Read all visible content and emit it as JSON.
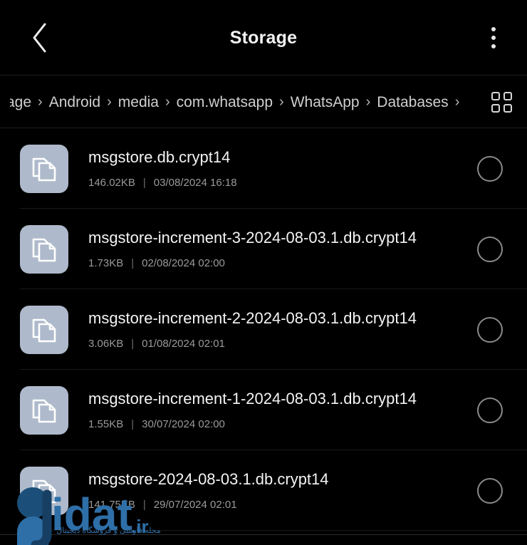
{
  "header": {
    "title": "Storage",
    "back_icon": "chevron-left-icon",
    "menu_icon": "more-vertical-icon"
  },
  "breadcrumb": {
    "separator": "›",
    "items": [
      {
        "label": "rage",
        "truncated": true
      },
      {
        "label": "Android",
        "truncated": false
      },
      {
        "label": "media",
        "truncated": false
      },
      {
        "label": "com.whatsapp",
        "truncated": false
      },
      {
        "label": "WhatsApp",
        "truncated": false
      },
      {
        "label": "Databases",
        "truncated": false
      }
    ],
    "trailing_separator": "›",
    "view_toggle_icon": "grid-view-icon"
  },
  "files": [
    {
      "name": "msgstore.db.crypt14",
      "size": "146.02KB",
      "modified": "03/08/2024 16:18",
      "icon": "file-document-icon",
      "selected": false
    },
    {
      "name": "msgstore-increment-3-2024-08-03.1.db.crypt14",
      "size": "1.73KB",
      "modified": "02/08/2024 02:00",
      "icon": "file-document-icon",
      "selected": false
    },
    {
      "name": "msgstore-increment-2-2024-08-03.1.db.crypt14",
      "size": "3.06KB",
      "modified": "01/08/2024 02:01",
      "icon": "file-document-icon",
      "selected": false
    },
    {
      "name": "msgstore-increment-1-2024-08-03.1.db.crypt14",
      "size": "1.55KB",
      "modified": "30/07/2024 02:00",
      "icon": "file-document-icon",
      "selected": false
    },
    {
      "name": "msgstore-2024-08-03.1.db.crypt14",
      "size": "141.75KB",
      "modified": "29/07/2024 02:01",
      "icon": "file-document-icon",
      "selected": false
    }
  ],
  "meta_separator": "|",
  "watermark": {
    "brand_g": "g",
    "brand_rest": "idat",
    "brand_tld": ".ir",
    "tagline": "مجله فارسی و فروشگاه دیجیتال"
  },
  "colors": {
    "background": "#000000",
    "icon_tile": "#aebacb",
    "primary_text": "#f4f4f4",
    "secondary_text": "#9a9a9a",
    "divider": "#1a1a1a",
    "watermark_blue": "#2f6ea8"
  }
}
